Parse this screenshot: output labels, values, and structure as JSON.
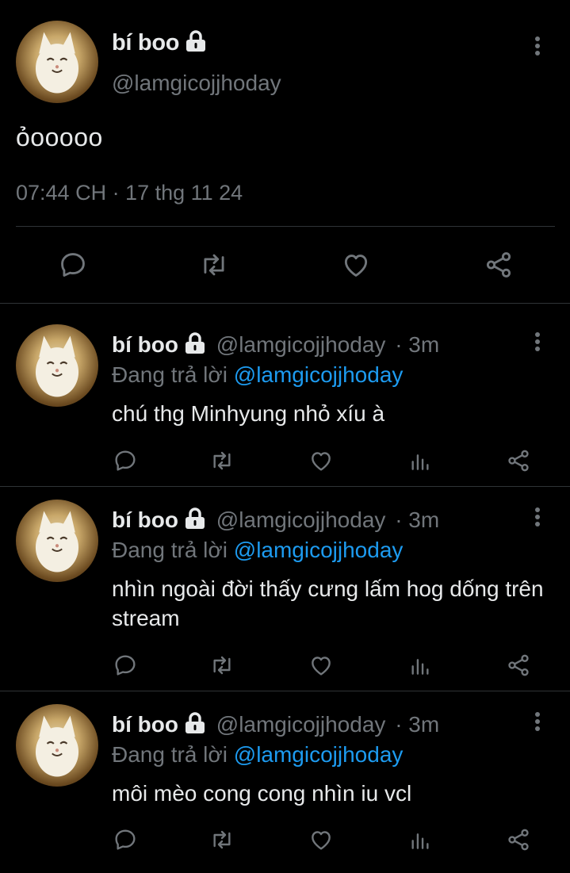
{
  "main_tweet": {
    "display_name": "bí boo",
    "handle": "@lamgicojjhoday",
    "text": "ỏooooo",
    "timestamp": "07:44 CH · 17 thg 11 24",
    "actions": [
      "reply-icon",
      "retweet-icon",
      "like-icon",
      "share-icon"
    ]
  },
  "replies": [
    {
      "display_name": "bí boo",
      "handle": "@lamgicojjhoday",
      "time": "· 3m",
      "replying_prefix": "Đang trả lời",
      "replying_to": "@lamgicojjhoday",
      "text": "chú thg Minhyung nhỏ xíu à"
    },
    {
      "display_name": "bí boo",
      "handle": "@lamgicojjhoday",
      "time": "· 3m",
      "replying_prefix": "Đang trả lời",
      "replying_to": "@lamgicojjhoday",
      "text": "nhìn ngoài đời thấy cưng lấm hog dống trên stream"
    },
    {
      "display_name": "bí boo",
      "handle": "@lamgicojjhoday",
      "time": "· 3m",
      "replying_prefix": "Đang trả lời",
      "replying_to": "@lamgicojjhoday",
      "text": "môi mèo cong cong nhìn iu vcl"
    }
  ],
  "colors": {
    "background": "#000000",
    "primary_text": "#e7e9ea",
    "secondary_text": "#71767b",
    "link": "#1d9bf0",
    "divider": "#2f3336"
  }
}
